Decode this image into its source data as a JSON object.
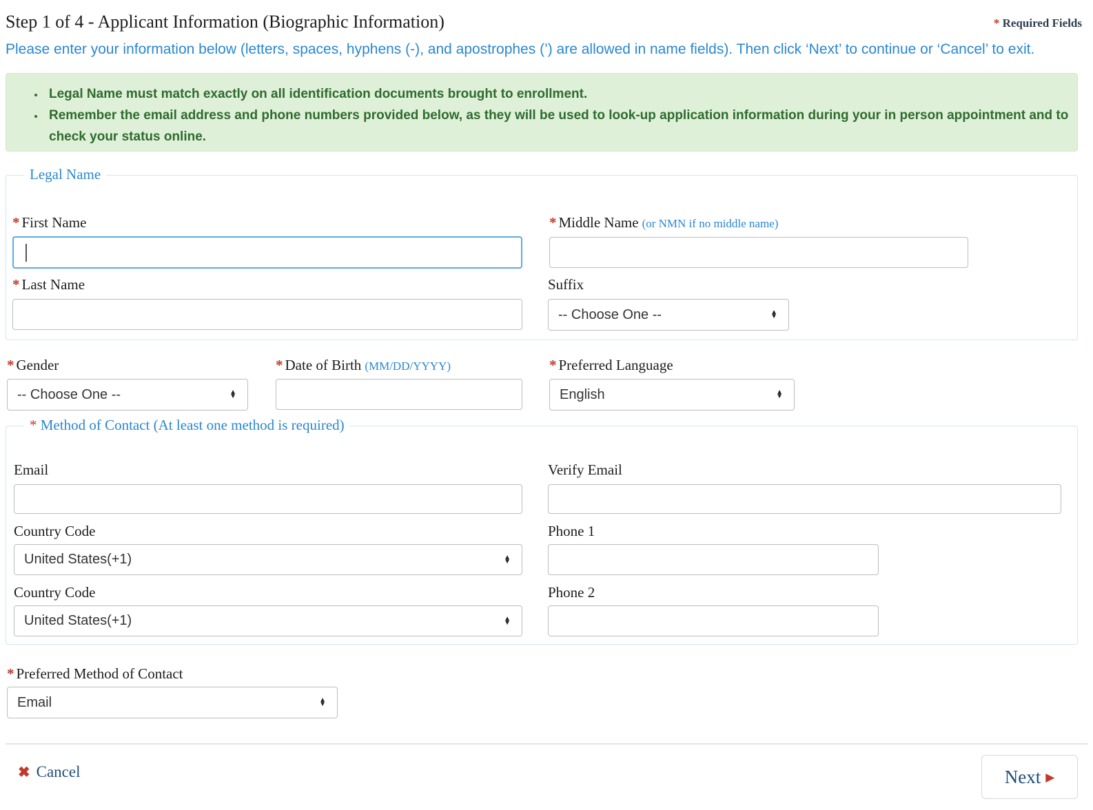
{
  "header": {
    "step_title": "Step 1 of 4 - Applicant Information (Biographic Information)",
    "required_star": "*",
    "required_label": "Required Fields",
    "instructions": "Please enter your information below (letters, spaces, hyphens (-), and apostrophes (’) are allowed in name fields). Then click ‘Next’ to continue or ‘Cancel’ to exit."
  },
  "alert": {
    "items": [
      "Legal Name must match exactly on all identification documents brought to enrollment.",
      "Remember the email address and phone numbers provided below, as they will be used to look-up application information during your in person appointment and to check your status online."
    ]
  },
  "legal_name": {
    "legend": "Legal Name",
    "first_name": {
      "star": "*",
      "label": "First Name",
      "value": "",
      "focused": true
    },
    "middle_name": {
      "star": "*",
      "label": "Middle Name",
      "hint": "(or NMN if no middle name)",
      "value": ""
    },
    "last_name": {
      "star": "*",
      "label": "Last Name",
      "value": ""
    },
    "suffix": {
      "label": "Suffix",
      "value": "-- Choose One --"
    }
  },
  "demographics": {
    "gender": {
      "star": "*",
      "label": "Gender",
      "value": "-- Choose One --"
    },
    "dob": {
      "star": "*",
      "label": "Date of Birth",
      "hint": "(MM/DD/YYYY)",
      "value": ""
    },
    "language": {
      "star": "*",
      "label": "Preferred Language",
      "value": "English"
    }
  },
  "contact": {
    "legend_star": "*",
    "legend": "Method of Contact (At least one method is required)",
    "email": {
      "label": "Email",
      "value": ""
    },
    "verify_email": {
      "label": "Verify Email",
      "value": ""
    },
    "country_code_1": {
      "label": "Country Code",
      "value": "United States(+1)"
    },
    "phone_1": {
      "label": "Phone 1",
      "value": ""
    },
    "country_code_2": {
      "label": "Country Code",
      "value": "United States(+1)"
    },
    "phone_2": {
      "label": "Phone 2",
      "value": ""
    }
  },
  "preferred_method": {
    "star": "*",
    "label": "Preferred Method of Contact",
    "value": "Email"
  },
  "footer": {
    "cancel_icon": "✖",
    "cancel_label": "Cancel",
    "next_label": "Next",
    "next_icon": "▶"
  },
  "colors": {
    "accent_blue": "#2a87d0",
    "required_red": "#c0392b",
    "alert_bg": "#dff0d8",
    "alert_text": "#2e6b2e",
    "link_blue": "#1f4e79",
    "field_border": "#bdbdbd",
    "focus_border": "#5bacdf"
  }
}
